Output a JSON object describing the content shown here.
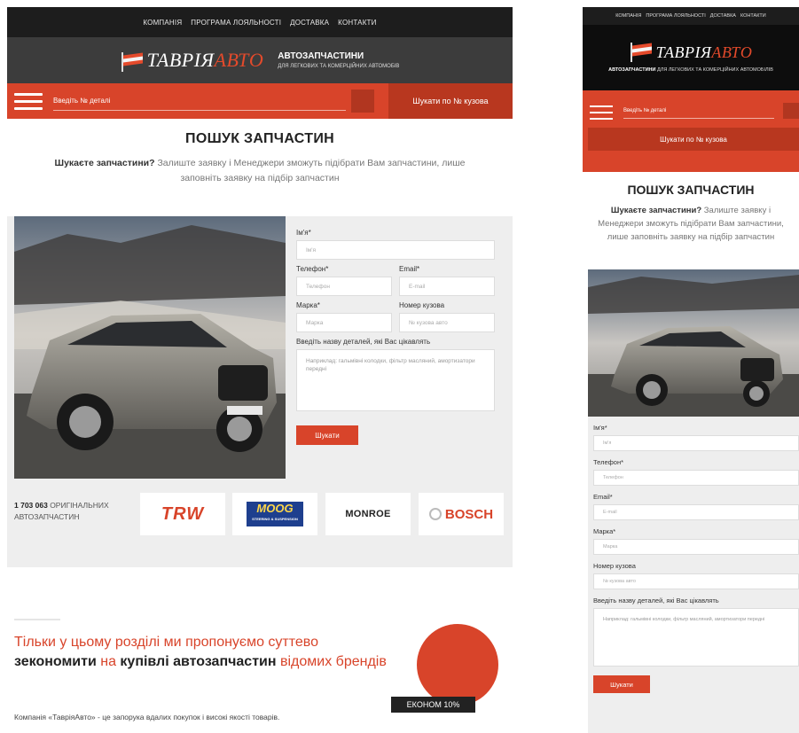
{
  "topnav": [
    "КОМПАНІЯ",
    "ПРОГРАМА ЛОЯЛЬНОСТІ",
    "ДОСТАВКА",
    "КОНТАКТИ"
  ],
  "logo": {
    "part1": "ТАВРІЯ",
    "part2": "АВТО"
  },
  "tagline": {
    "title": "АВТОЗАПЧАСТИНИ",
    "subtitle": "ДЛЯ ЛЕГКОВИХ ТА КОМЕРЦІЙНИХ АВТОМОБІВ"
  },
  "search": {
    "placeholder": "Введіть № деталі",
    "vin_button": "Шукати по № кузова"
  },
  "page": {
    "title": "ПОШУК ЗАПЧАСТИН",
    "intro_bold": "Шукаєте запчастини?",
    "intro_text": " Залиште заявку і Менеджери зможуть підібрати Вам запчастини, лише заповніть заявку на підбір запчастин"
  },
  "form": {
    "name_label": "Ім'я*",
    "name_placeholder": "Ім'я",
    "phone_label": "Телефон*",
    "phone_placeholder": "Телефон",
    "email_label": "Email*",
    "email_placeholder": "E-mail",
    "brand_label": "Марка*",
    "brand_placeholder": "Марка",
    "vin_label": "Номер кузова",
    "vin_placeholder": "№ кузова авто",
    "details_label": "Введіть назву деталей, які Вас цікавлять",
    "details_placeholder": "Наприклад: гальмівні колодки, фільтр масляний, амортизатори передні",
    "submit": "Шукати"
  },
  "brands": {
    "count": "1 703 063",
    "count_text": " ОРИГІНАЛЬНИХ АВТОЗАПЧАСТИН",
    "trw": "TRW",
    "moog": "MOOG",
    "moog_sub": "STEERING & SUSPENSION",
    "monroe": "MONROE",
    "bosch": "BOSCH"
  },
  "promo": {
    "line_pre": "Тільки у цьому розділі ми пропонуємо суттево ",
    "bold1": "зекономити",
    "mid": " на ",
    "bold2": "купівлі автозапчастин",
    "line_post": " відомих брендів",
    "badge": "ЕКОНОМ 10%",
    "sub": "Компанія «ТавріяАвто» - це запорука вдалих покупок і високі якості товарів."
  },
  "mobile": {
    "topnav": [
      "КОМПАНІЯ",
      "ПРОГРАМА ЛОЯЛЬНОСТІ",
      "ДОСТАВКА",
      "КОНТАКТИ"
    ],
    "tag_bold": "АВТОЗАПЧАСТИНИ",
    "tag_rest": " ДЛЯ ЛЕГКОВИХ ТА КОМЕРЦІЙНИХ АВТОМОБІЛІВ"
  },
  "colors": {
    "accent": "#d8442a",
    "dark": "#1d1d1d",
    "header": "#3c3c3c",
    "panel": "#eeeeee"
  }
}
